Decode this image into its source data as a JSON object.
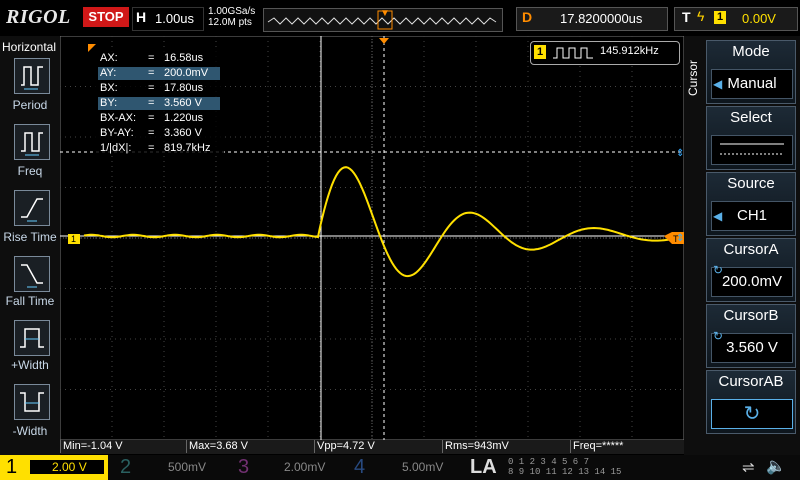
{
  "brand": "RIGOL",
  "run_state": "STOP",
  "timebase": {
    "letter": "H",
    "scale": "1.00us",
    "sample_rate": "1.00GSa/s",
    "memory": "12.0M pts"
  },
  "delay": {
    "letter": "D",
    "value": "17.8200000us"
  },
  "trigger": {
    "letter": "T",
    "slope": "ϟ",
    "source": "1",
    "level": "0.00V"
  },
  "left_menu": {
    "title": "Horizontal",
    "items": [
      {
        "label": "Period"
      },
      {
        "label": "Freq"
      },
      {
        "label": "Rise Time"
      },
      {
        "label": "Fall Time"
      },
      {
        "label": "+Width"
      },
      {
        "label": "-Width"
      }
    ]
  },
  "cursor_readout": [
    {
      "key": "AX:",
      "eq": "=",
      "value": "16.58us",
      "highlight": false
    },
    {
      "key": "AY:",
      "eq": "=",
      "value": "200.0mV",
      "highlight": true
    },
    {
      "key": "BX:",
      "eq": "=",
      "value": "17.80us",
      "highlight": false
    },
    {
      "key": "BY:",
      "eq": "=",
      "value": "3.560 V",
      "highlight": true
    },
    {
      "key": "BX-AX:",
      "eq": "=",
      "value": "1.220us",
      "highlight": false
    },
    {
      "key": "BY-AY:",
      "eq": "=",
      "value": "3.360 V",
      "highlight": false
    },
    {
      "key": "1/|dX|:",
      "eq": "=",
      "value": "819.7kHz",
      "highlight": false
    }
  ],
  "freq_counter": {
    "channel": "1",
    "value": "145.912kHz"
  },
  "right_menu": {
    "title": "Cursor",
    "items": [
      {
        "title": "Mode",
        "value": "Manual"
      },
      {
        "title": "Select",
        "value": ""
      },
      {
        "title": "Source",
        "value": "CH1"
      },
      {
        "title": "CursorA",
        "value": "200.0mV"
      },
      {
        "title": "CursorB",
        "value": "3.560 V"
      },
      {
        "title": "CursorAB",
        "value": ""
      }
    ]
  },
  "measurements": [
    {
      "text": "Min=-1.04 V"
    },
    {
      "text": "Max=3.68 V"
    },
    {
      "text": "Vpp=4.72 V"
    },
    {
      "text": "Rms=943mV"
    },
    {
      "text": "Freq=*****"
    }
  ],
  "channels": [
    {
      "num": "1",
      "scale": "2.00 V",
      "color": "#ffe000"
    },
    {
      "num": "2",
      "scale": "500mV",
      "color": "#00c8c8"
    },
    {
      "num": "3",
      "scale": "2.00mV",
      "color": "#e040e0"
    },
    {
      "num": "4",
      "scale": "5.00mV",
      "color": "#3080ff"
    }
  ],
  "la": {
    "label": "LA",
    "digits_top": "0 1 2 3   4 5 6 7",
    "digits_bottom": "8 9 10 11  12 13 14 15"
  },
  "colors": {
    "ch1": "#ffe000",
    "accent": "#ff8c00",
    "grid": "#4a4a4a"
  }
}
